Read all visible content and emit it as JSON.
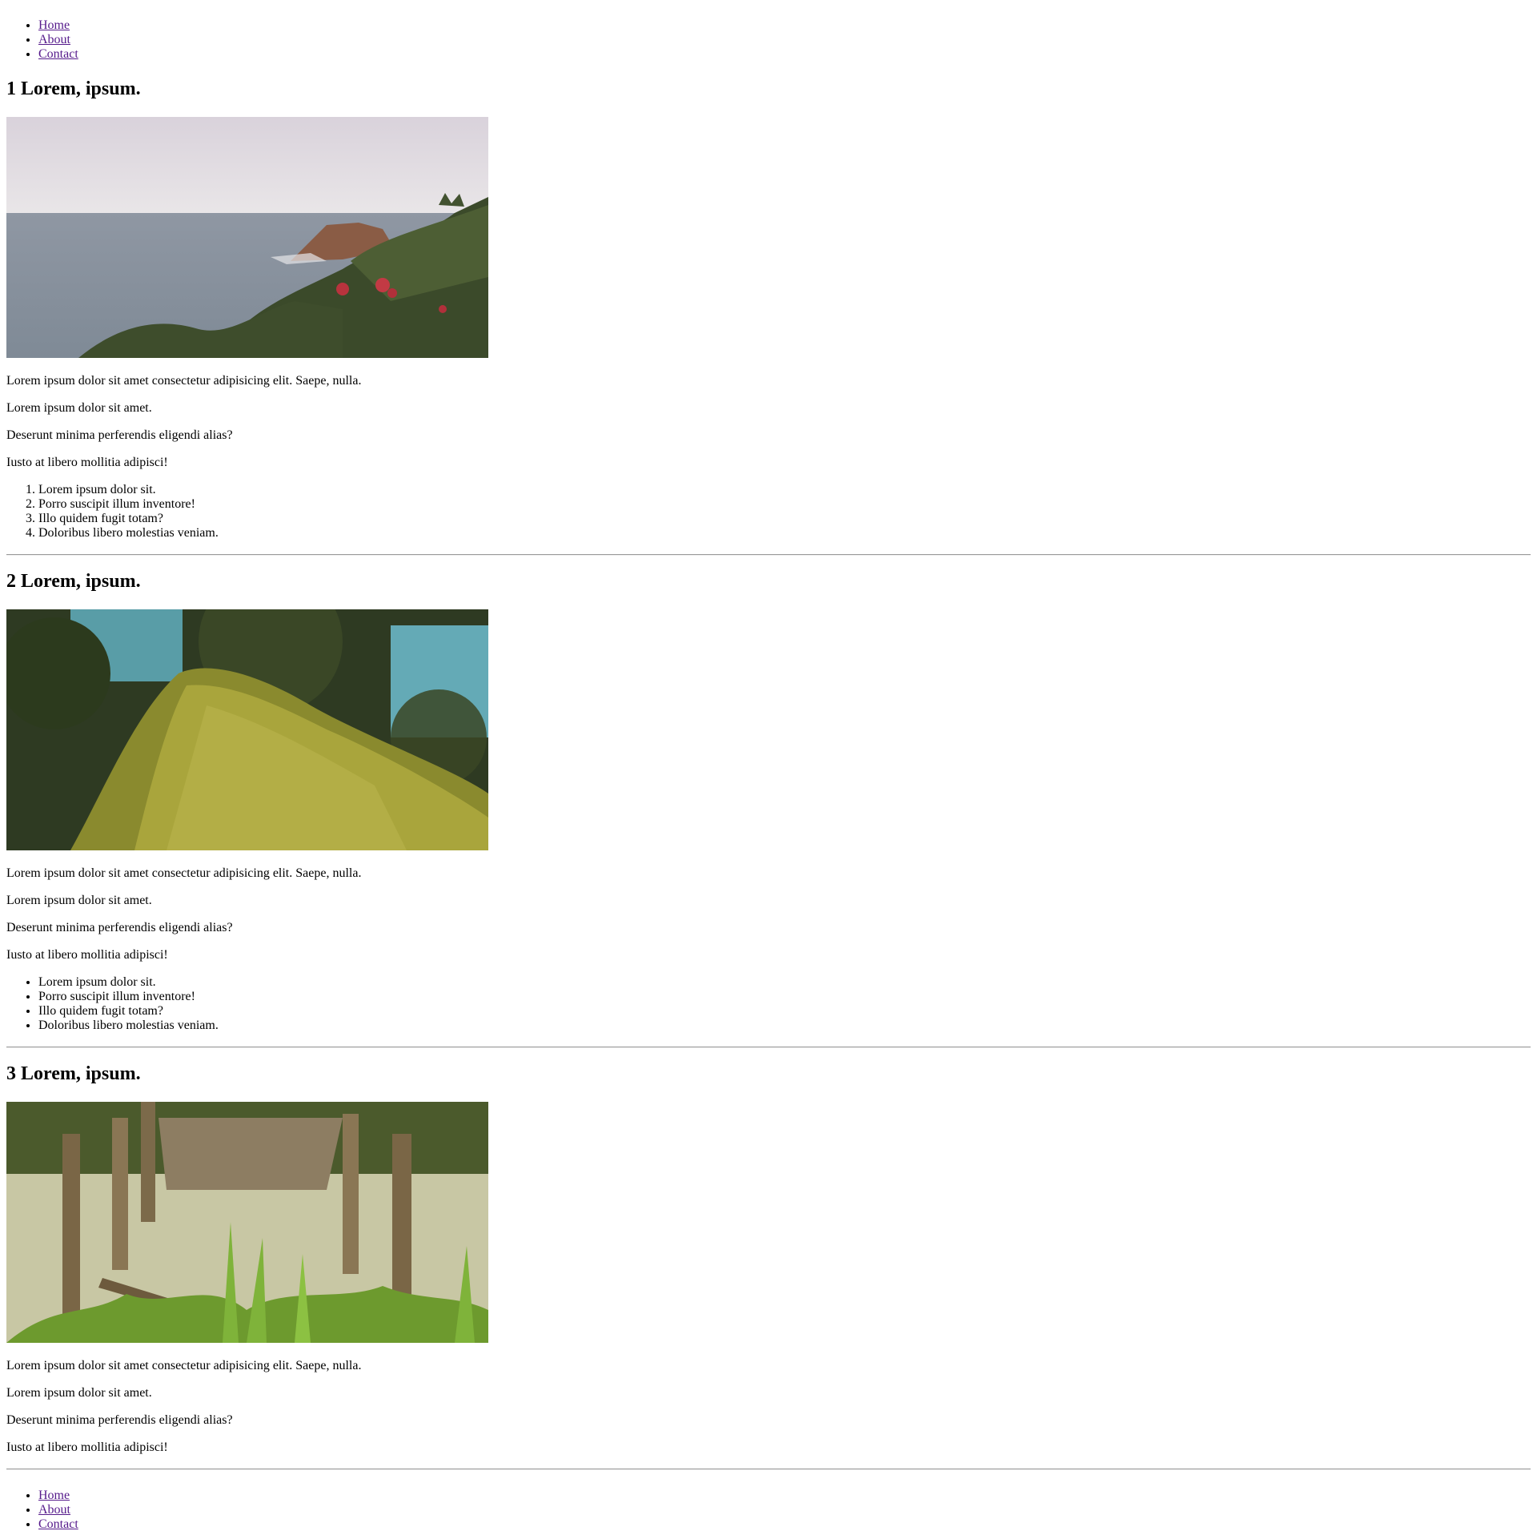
{
  "nav_top": [
    "Home",
    "About",
    "Contact"
  ],
  "nav_bottom": [
    "Home",
    "About",
    "Contact"
  ],
  "sections": [
    {
      "title": "1 Lorem, ipsum.",
      "image_icon": "coastal-cliff-photo",
      "paragraphs": [
        "Lorem ipsum dolor sit amet consectetur adipisicing elit. Saepe, nulla.",
        "Lorem ipsum dolor sit amet.",
        "Deserunt minima perferendis eligendi alias?",
        "Iusto at libero mollitia adipisci!"
      ],
      "list_type": "ordered",
      "list": [
        "Lorem ipsum dolor sit.",
        "Porro suscipit illum inventore!",
        "Illo quidem fugit totam?",
        "Doloribus libero molestias veniam."
      ]
    },
    {
      "title": "2 Lorem, ipsum.",
      "image_icon": "mossy-tree-trunk-photo",
      "paragraphs": [
        "Lorem ipsum dolor sit amet consectetur adipisicing elit. Saepe, nulla.",
        "Lorem ipsum dolor sit amet.",
        "Deserunt minima perferendis eligendi alias?",
        "Iusto at libero mollitia adipisci!"
      ],
      "list_type": "unordered",
      "list": [
        "Lorem ipsum dolor sit.",
        "Porro suscipit illum inventore!",
        "Illo quidem fugit totam?",
        "Doloribus libero molestias veniam."
      ]
    },
    {
      "title": "3 Lorem, ipsum.",
      "image_icon": "broken-wooden-dock-photo",
      "paragraphs": [
        "Lorem ipsum dolor sit amet consectetur adipisicing elit. Saepe, nulla.",
        "Lorem ipsum dolor sit amet.",
        "Deserunt minima perferendis eligendi alias?",
        "Iusto at libero mollitia adipisci!"
      ]
    }
  ],
  "colors": {
    "link": "#551a8b",
    "text": "#000000",
    "background": "#ffffff",
    "rule": "#9a9a9a"
  }
}
